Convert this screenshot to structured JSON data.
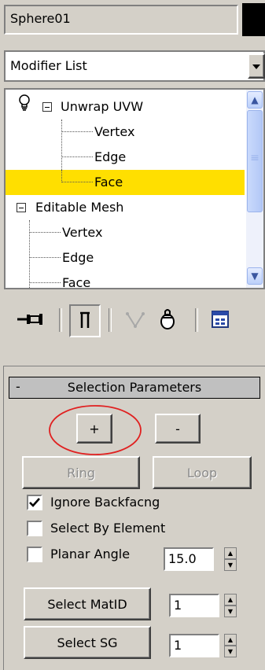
{
  "object": {
    "name": "Sphere01",
    "color": "#000000"
  },
  "modifier_list": {
    "selected": "Modifier List"
  },
  "stack": {
    "items": [
      {
        "label": "Unwrap UVW",
        "level": "modifier"
      },
      {
        "label": "Vertex",
        "level": "sub"
      },
      {
        "label": "Edge",
        "level": "sub"
      },
      {
        "label": "Face",
        "level": "sub",
        "selected": true
      },
      {
        "label": "Editable Mesh",
        "level": "modifier"
      },
      {
        "label": "Vertex",
        "level": "sub"
      },
      {
        "label": "Edge",
        "level": "sub"
      },
      {
        "label": "Face",
        "level": "sub"
      }
    ],
    "selected_color": "#ffdf00",
    "scrollbar": {
      "up": "▲",
      "down": "▼",
      "grip": "≡"
    }
  },
  "toolbar": {
    "icons": [
      "pin-stack-icon",
      "show-end-result-icon",
      "make-unique-icon",
      "remove-modifier-icon",
      "configure-modifier-sets-icon"
    ]
  },
  "rollout": {
    "collapse_symbol": "-",
    "title": "Selection Parameters",
    "grow_label": "+",
    "shrink_label": "-",
    "ring_label": "Ring",
    "loop_label": "Loop",
    "ignore_backfacing": {
      "label": "Ignore Backfacng",
      "checked": true
    },
    "select_by_element": {
      "label": "Select By Element",
      "checked": false
    },
    "planar_angle": {
      "label": "Planar Angle",
      "checked": false,
      "value": "15.0"
    },
    "select_matid": {
      "label": "Select MatID",
      "value": "1"
    },
    "select_sg": {
      "label": "Select SG",
      "value": "1"
    }
  },
  "annotation": {
    "color": "#e02020"
  }
}
